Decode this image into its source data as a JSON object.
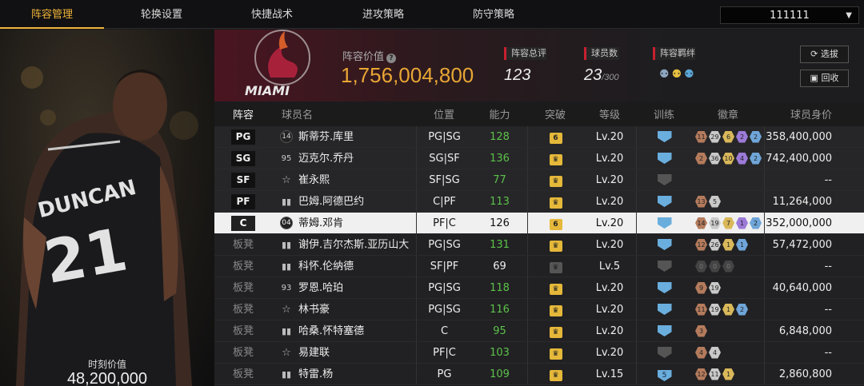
{
  "nav": {
    "tabs": [
      {
        "label": "阵容管理",
        "active": true
      },
      {
        "label": "轮换设置",
        "active": false
      },
      {
        "label": "快捷战术",
        "active": false
      },
      {
        "label": "进攻策略",
        "active": false
      },
      {
        "label": "防守策略",
        "active": false
      }
    ],
    "team_select": "111111"
  },
  "left_panel": {
    "jersey_name": "DUNCAN",
    "jersey_number": "21",
    "moment_value_label": "时刻价值",
    "moment_value": "48,200,000"
  },
  "header": {
    "team_logo_text": "MIAMI",
    "lineup_value_label": "阵容价值",
    "lineup_value": "1,756,004,800",
    "rating_label": "阵容总评",
    "rating": "123",
    "player_count_label": "球员数",
    "player_count": "23",
    "player_count_max": "/300",
    "bond_label": "阵容羁绊",
    "select_button": "选拔",
    "recycle_button": "回收"
  },
  "table": {
    "columns": [
      "阵容",
      "球员名",
      "位置",
      "能力",
      "突破",
      "等级",
      "训练",
      "徽章",
      "球员身价"
    ],
    "rows": [
      {
        "slot": "PG",
        "icon": "14",
        "icon_type": "num",
        "name": "斯蒂芬.库里",
        "position": "PG|SG",
        "ability": "128",
        "breakthrough": "6",
        "level": "Lv.20",
        "training": "",
        "badges": [
          [
            "11",
            "br"
          ],
          [
            "29",
            "sv"
          ],
          [
            "6",
            "gd"
          ],
          [
            "2",
            "pu"
          ],
          [
            "2",
            "bl"
          ]
        ],
        "value": "358,400,000"
      },
      {
        "slot": "SG",
        "icon": "95",
        "icon_type": "plain",
        "name": "迈克尔.乔丹",
        "position": "SG|SF",
        "ability": "136",
        "breakthrough": "crown",
        "level": "Lv.20",
        "training": "",
        "badges": [
          [
            "2",
            "br"
          ],
          [
            "36",
            "sv"
          ],
          [
            "10",
            "gd"
          ],
          [
            "4",
            "pu"
          ],
          [
            "2",
            "bl"
          ]
        ],
        "value": "742,400,000"
      },
      {
        "slot": "SF",
        "icon": "☆",
        "icon_type": "star",
        "name": "崔永熙",
        "position": "SF|SG",
        "ability": "77",
        "breakthrough": "crown",
        "level": "Lv.20",
        "training": "gray",
        "badges": [],
        "value": "--"
      },
      {
        "slot": "PF",
        "icon": "▮",
        "icon_type": "bars",
        "name": "巴姆.阿德巴约",
        "position": "C|PF",
        "ability": "113",
        "breakthrough": "crown",
        "level": "Lv.20",
        "training": "",
        "badges": [
          [
            "13",
            "br"
          ],
          [
            "5",
            "sv"
          ]
        ],
        "value": "11,264,000"
      },
      {
        "slot": "C",
        "icon": "04",
        "icon_type": "num",
        "name": "蒂姆.邓肯",
        "position": "PF|C",
        "ability": "126",
        "breakthrough": "6",
        "level": "Lv.20",
        "training": "",
        "badges": [
          [
            "14",
            "br"
          ],
          [
            "19",
            "sv"
          ],
          [
            "7",
            "gd"
          ],
          [
            "1",
            "pu"
          ],
          [
            "2",
            "bl"
          ]
        ],
        "value": "352,000,000",
        "selected": true
      },
      {
        "slot": "板凳",
        "icon": "▮",
        "icon_type": "bars",
        "name": "谢伊.吉尔杰斯.亚历山大",
        "position": "PG|SG",
        "ability": "131",
        "breakthrough": "crown",
        "level": "Lv.20",
        "training": "",
        "badges": [
          [
            "12",
            "br"
          ],
          [
            "26",
            "sv"
          ],
          [
            "1",
            "gd"
          ],
          [
            "1",
            "bl"
          ]
        ],
        "value": "57,472,000"
      },
      {
        "slot": "板凳",
        "icon": "▮",
        "icon_type": "bars",
        "name": "科怀.伦纳德",
        "position": "SF|PF",
        "ability": "69",
        "breakthrough": "gray",
        "level": "Lv.5",
        "training": "gray",
        "badges": [
          [
            "0",
            "dk"
          ],
          [
            "0",
            "dk"
          ],
          [
            "0",
            "dk"
          ]
        ],
        "value": "--"
      },
      {
        "slot": "板凳",
        "icon": "93",
        "icon_type": "plain",
        "name": "罗恩.哈珀",
        "position": "PG|SG",
        "ability": "118",
        "breakthrough": "crown",
        "level": "Lv.20",
        "training": "",
        "badges": [
          [
            "9",
            "br"
          ],
          [
            "19",
            "sv"
          ]
        ],
        "value": "40,640,000"
      },
      {
        "slot": "板凳",
        "icon": "☆",
        "icon_type": "star",
        "name": "林书豪",
        "position": "PG|SG",
        "ability": "116",
        "breakthrough": "crown",
        "level": "Lv.20",
        "training": "",
        "badges": [
          [
            "11",
            "br"
          ],
          [
            "19",
            "sv"
          ],
          [
            "1",
            "gd"
          ],
          [
            "2",
            "bl"
          ]
        ],
        "value": "--"
      },
      {
        "slot": "板凳",
        "icon": "▮",
        "icon_type": "bars",
        "name": "哈桑.怀特塞德",
        "position": "C",
        "ability": "95",
        "breakthrough": "crown",
        "level": "Lv.20",
        "training": "",
        "badges": [
          [
            "3",
            "br"
          ]
        ],
        "value": "6,848,000"
      },
      {
        "slot": "板凳",
        "icon": "☆",
        "icon_type": "star",
        "name": "易建联",
        "position": "PF|C",
        "ability": "103",
        "breakthrough": "crown",
        "level": "Lv.20",
        "training": "gray",
        "badges": [
          [
            "4",
            "br"
          ],
          [
            "4",
            "sv"
          ]
        ],
        "value": "--"
      },
      {
        "slot": "板凳",
        "icon": "▮",
        "icon_type": "bars",
        "name": "特雷.杨",
        "position": "PG",
        "ability": "109",
        "breakthrough": "crown",
        "level": "Lv.15",
        "training": "5",
        "badges": [
          [
            "12",
            "br"
          ],
          [
            "11",
            "sv"
          ],
          [
            "1",
            "gd"
          ]
        ],
        "value": "2,860,800"
      }
    ]
  },
  "colors": {
    "accent": "#f1b43a",
    "value_gold": "#e8a634",
    "ability_green": "#5cc24a",
    "brand_red": "#c8202f"
  }
}
